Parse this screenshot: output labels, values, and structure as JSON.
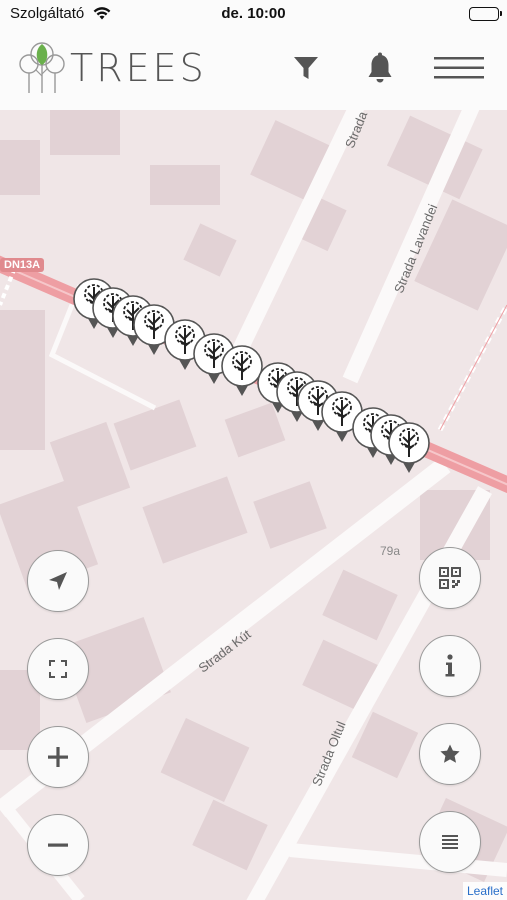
{
  "status_bar": {
    "carrier": "Szolgáltató",
    "time": "de. 10:00"
  },
  "header": {
    "brand": "TREES",
    "icons": [
      "filter-icon",
      "bell-icon",
      "menu-icon"
    ]
  },
  "map": {
    "road_badge": "DN13A",
    "streets": [
      "Strada",
      "Strada Lavandei",
      "Strada Kút",
      "Strada Oltul"
    ],
    "house_number": "79a",
    "attribution": "Leaflet"
  },
  "left_controls": [
    "locate-icon",
    "fullscreen-icon",
    "zoom-in-icon",
    "zoom-out-icon"
  ],
  "right_controls": [
    "qr-code-icon",
    "info-icon",
    "star-icon",
    "list-icon"
  ],
  "colors": {
    "accent_green": "#6ab04c",
    "map_overlay": "#f2e9ea",
    "road_red": "#ee9ea3"
  }
}
